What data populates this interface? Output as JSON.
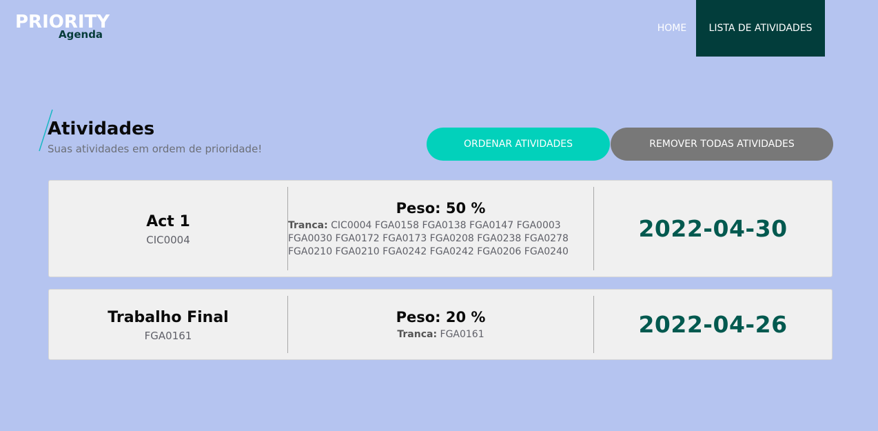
{
  "colors": {
    "background": "#b5c4f0",
    "nav_active": "#023d3b",
    "order_button": "#02d1bb",
    "remove_button": "#787878",
    "date_text": "#02594f"
  },
  "logo": {
    "main": "PRIORITY",
    "sub": "Agenda"
  },
  "nav": {
    "home": "HOME",
    "list": "LISTA DE ATIVIDADES"
  },
  "header": {
    "title": "Atividades",
    "subtitle": "Suas atividades em ordem de prioridade!"
  },
  "actions": {
    "order_label": "ORDENAR ATIVIDADES",
    "remove_label": "REMOVER TODAS ATIVIDADES"
  },
  "activities": [
    {
      "name": "Act 1",
      "code": "CIC0004",
      "peso": "Peso: 50 %",
      "tranca_label": "Tranca:",
      "tranca_codes": "CIC0004 FGA0158 FGA0138 FGA0147 FGA0003 FGA0030 FGA0172 FGA0173 FGA0208 FGA0238 FGA0278 FGA0210 FGA0210 FGA0242 FGA0242 FGA0206 FGA0240",
      "date": "2022-04-30"
    },
    {
      "name": "Trabalho Final",
      "code": "FGA0161",
      "peso": "Peso: 20 %",
      "tranca_label": "Tranca:",
      "tranca_codes": "FGA0161",
      "date": "2022-04-26"
    }
  ]
}
